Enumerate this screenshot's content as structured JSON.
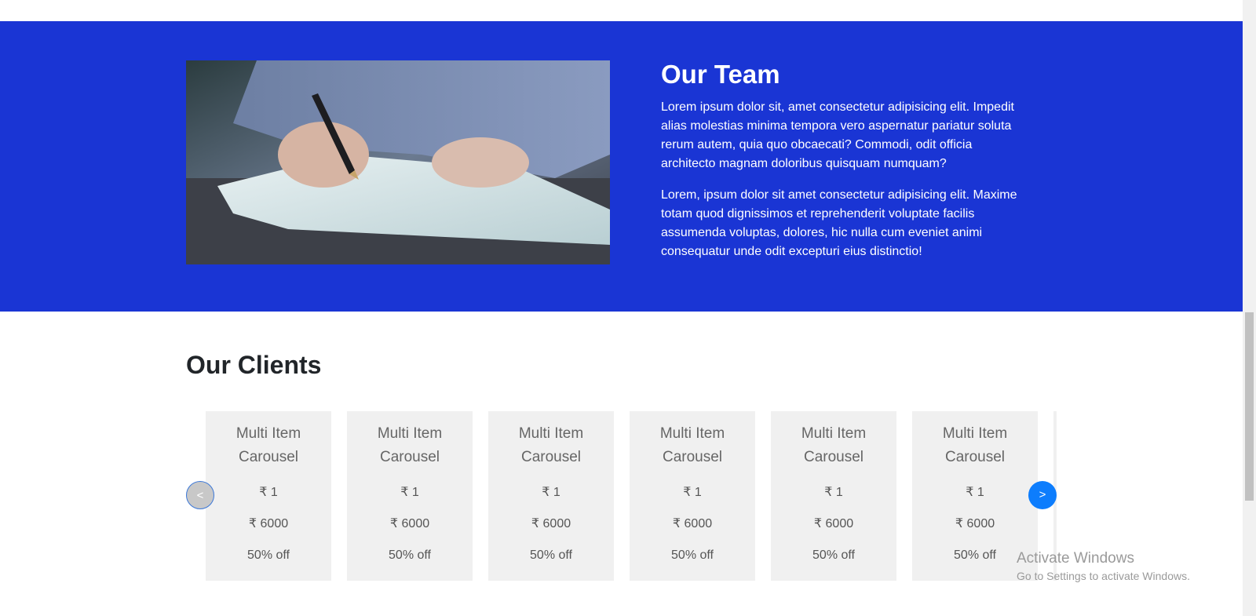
{
  "team": {
    "title": "Our Team",
    "paragraphs": [
      "Lorem ipsum dolor sit, amet consectetur adipisicing elit. Impedit alias molestias minima tempora vero aspernatur pariatur soluta rerum autem, quia quo obcaecati? Commodi, odit officia architecto magnam doloribus quisquam numquam?",
      "Lorem, ipsum dolor sit amet consectetur adipisicing elit. Maxime totam quod dignissimos et reprehenderit voluptate facilis assumenda voluptas, dolores, hic nulla cum eveniet animi consequatur unde odit excepturi eius distinctio!"
    ],
    "photo_icon": "person-writing-photo"
  },
  "clients": {
    "title": "Our Clients",
    "prev_label": "<",
    "next_label": ">",
    "cards": [
      {
        "title": "Multi Item Carousel",
        "price": "₹ 1",
        "old_price": "₹ 6000",
        "discount": "50% off"
      },
      {
        "title": "Multi Item Carousel",
        "price": "₹ 1",
        "old_price": "₹ 6000",
        "discount": "50% off"
      },
      {
        "title": "Multi Item Carousel",
        "price": "₹ 1",
        "old_price": "₹ 6000",
        "discount": "50% off"
      },
      {
        "title": "Multi Item Carousel",
        "price": "₹ 1",
        "old_price": "₹ 6000",
        "discount": "50% off"
      },
      {
        "title": "Multi Item Carousel",
        "price": "₹ 1",
        "old_price": "₹ 6000",
        "discount": "50% off"
      },
      {
        "title": "Multi Item Carousel",
        "price": "₹ 1",
        "old_price": "₹ 6000",
        "discount": "50% off"
      }
    ]
  },
  "watermark": {
    "title": "Activate Windows",
    "subtitle": "Go to Settings to activate Windows."
  },
  "colors": {
    "team_bg": "#1a35d4",
    "card_bg": "#f0f0f0",
    "next_button": "#0d7dfd"
  }
}
